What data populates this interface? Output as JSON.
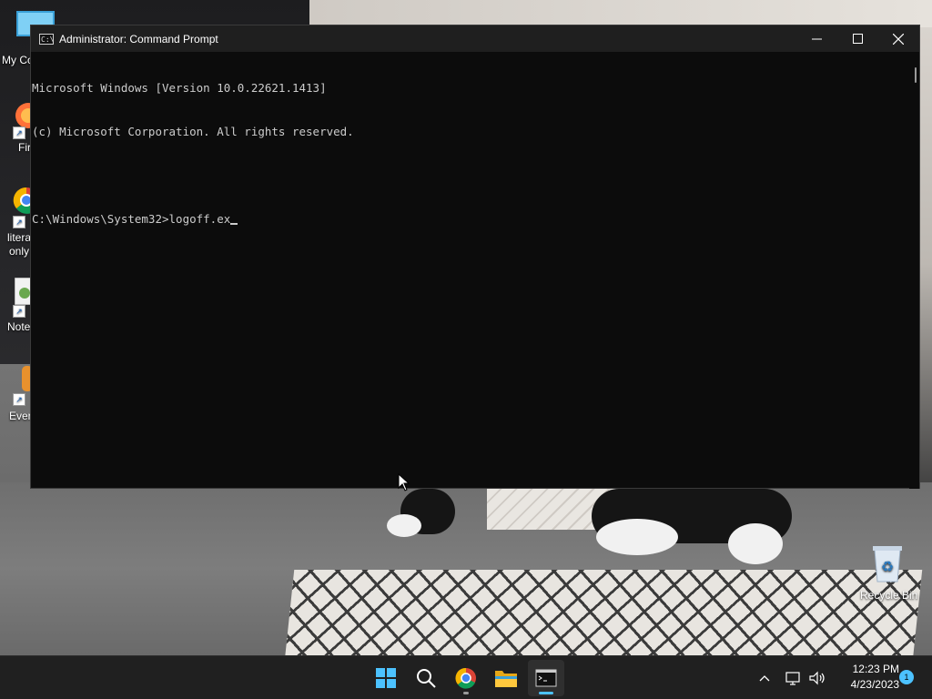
{
  "desktop": {
    "icons": [
      {
        "label": "My Co",
        "icon": "computer-icon"
      },
      {
        "label": "Fir",
        "icon": "firefox-icon"
      },
      {
        "label": "litera",
        "label2": "only",
        "icon": "chrome-icon"
      },
      {
        "label": "Note",
        "icon": "notepad-icon"
      },
      {
        "label": "Ever",
        "icon": "evernote-icon"
      }
    ],
    "recycle_bin": {
      "label": "Recycle Bin",
      "icon": "recycle-bin-icon"
    }
  },
  "window": {
    "title": "Administrator: Command Prompt",
    "minimize_symbol": "—",
    "maximize_symbol": "☐",
    "close_symbol": "✕",
    "console_lines": [
      "Microsoft Windows [Version 10.0.22621.1413]",
      "(c) Microsoft Corporation. All rights reserved.",
      "",
      "C:\\Windows\\System32>logoff.ex"
    ]
  },
  "taskbar": {
    "apps": [
      {
        "name": "start",
        "icon": "windows-start-icon"
      },
      {
        "name": "search",
        "icon": "search-icon"
      },
      {
        "name": "chrome",
        "icon": "chrome-icon"
      },
      {
        "name": "file-explorer",
        "icon": "folder-icon"
      },
      {
        "name": "terminal",
        "icon": "terminal-icon",
        "active": true
      }
    ],
    "tray": {
      "chevron": "^",
      "time": "12:23 PM",
      "date": "4/23/2023",
      "notification_count": "1"
    }
  },
  "colors": {
    "console_bg": "#0c0c0c",
    "console_text": "#cccccc",
    "taskbar_bg": "#202020",
    "accent": "#4cc2ff"
  }
}
